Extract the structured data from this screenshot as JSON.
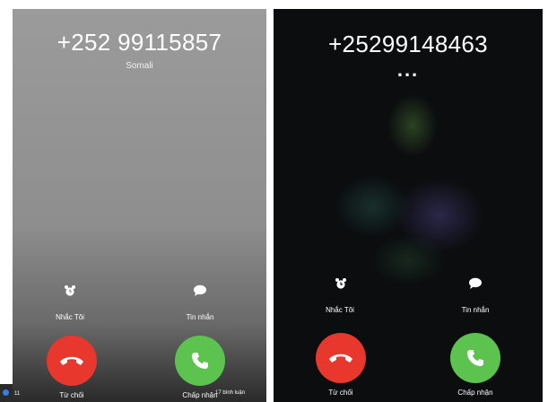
{
  "left_screen": {
    "caller_number": "+252 99115857",
    "caller_location": "Somali",
    "remind_label": "Nhắc Tôi",
    "message_label": "Tin nhắn",
    "decline_label": "Từ chối",
    "accept_label": "Chấp nhận",
    "overlay_count": "11",
    "overlay_comments": "17 bình luận"
  },
  "right_screen": {
    "caller_number": "+25299148463",
    "status_dots": "...",
    "remind_label": "Nhắc Tôi",
    "message_label": "Tin nhắn",
    "decline_label": "Từ chối",
    "accept_label": "Chấp nhận"
  },
  "colors": {
    "decline": "#e8372c",
    "accept": "#5cc34f",
    "left_background": "#9b9b9b",
    "right_background": "#0b0d0f"
  },
  "icons": {
    "remind": "alarm-clock-icon",
    "message": "speech-bubble-icon",
    "decline": "phone-hangup-icon",
    "accept": "phone-icon"
  }
}
